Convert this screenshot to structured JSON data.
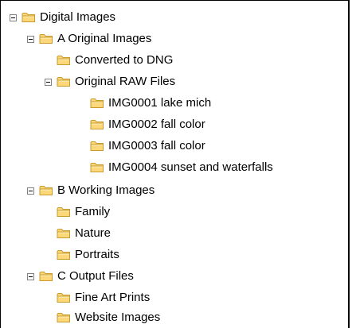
{
  "tree": {
    "root": {
      "label": "Digital Images",
      "expanded": true,
      "children": [
        {
          "label": "A Original Images",
          "expanded": true,
          "children": [
            {
              "label": "Converted to DNG"
            },
            {
              "label": "Original RAW Files",
              "expanded": true,
              "children": [
                {
                  "label": "IMG0001 lake mich"
                },
                {
                  "label": "IMG0002 fall color"
                },
                {
                  "label": "IMG0003 fall color"
                },
                {
                  "label": "IMG0004 sunset and waterfalls"
                }
              ]
            }
          ]
        },
        {
          "label": "B Working Images",
          "expanded": true,
          "children": [
            {
              "label": "Family"
            },
            {
              "label": "Nature"
            },
            {
              "label": "Portraits"
            }
          ]
        },
        {
          "label": "C Output Files",
          "expanded": true,
          "children": [
            {
              "label": "Fine Art Prints"
            },
            {
              "label": "Website Images"
            }
          ]
        }
      ]
    }
  },
  "colors": {
    "folder_fill": "#FCD87A",
    "folder_stroke": "#C89B2C",
    "toggle_border": "#808080",
    "panel_border": "#000000"
  },
  "icons": {
    "expander": "minus-box-icon",
    "folder": "folder-icon"
  }
}
